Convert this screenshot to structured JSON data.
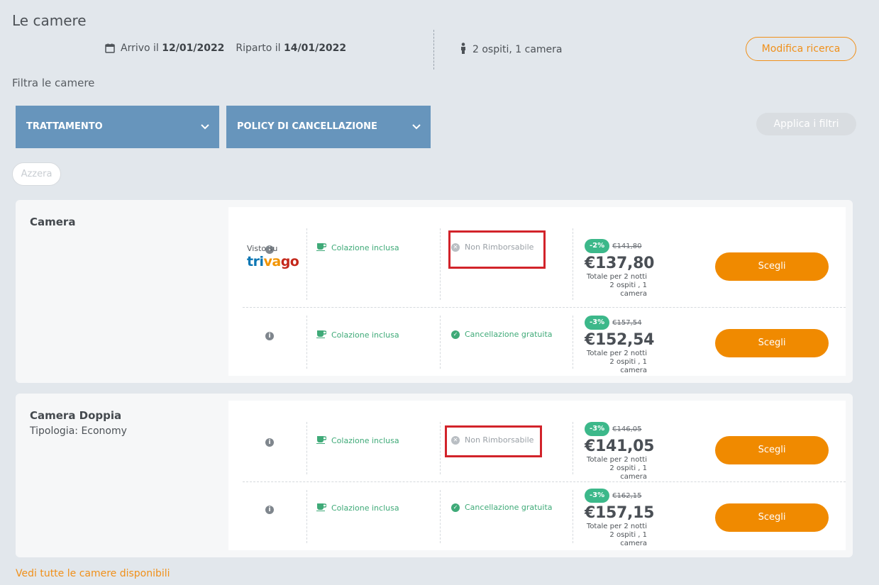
{
  "header": {
    "title": "Le camere",
    "arrival_label": "Arrivo il",
    "arrival_date": "12/01/2022",
    "departure_label": "Riparto il",
    "departure_date": "14/01/2022",
    "guests": "2 ospiti, 1 camera",
    "modify_button": "Modifica ricerca"
  },
  "filters": {
    "label": "Filtra le camere",
    "treatment": "TRATTAMENTO",
    "cancellation_policy": "POLICY DI CANCELLAZIONE",
    "apply_button": "Applica i filtri",
    "reset_button": "Azzera"
  },
  "rooms": [
    {
      "name": "Camera",
      "subtitle": "",
      "rates": [
        {
          "source_label": "Visto su",
          "source_logo": "trivago",
          "meal": "Colazione inclusa",
          "policy": "Non Rimborsabile",
          "discount": "-2%",
          "old_price": "€141,80",
          "price": "€137,80",
          "note_1": "Totale per 2 notti",
          "note_2": "2 ospiti , 1 camera",
          "button": "Scegli"
        },
        {
          "meal": "Colazione inclusa",
          "policy": "Cancellazione gratuita",
          "discount": "-3%",
          "old_price": "€157,54",
          "price": "€152,54",
          "note_1": "Totale per 2 notti",
          "note_2": "2 ospiti , 1 camera",
          "button": "Scegli"
        }
      ]
    },
    {
      "name": "Camera Doppia",
      "subtitle": "Tipologia: Economy",
      "rates": [
        {
          "meal": "Colazione inclusa",
          "policy": "Non Rimborsabile",
          "discount": "-3%",
          "old_price": "€146,05",
          "price": "€141,05",
          "note_1": "Totale per 2 notti",
          "note_2": "2 ospiti , 1 camera",
          "button": "Scegli"
        },
        {
          "meal": "Colazione inclusa",
          "policy": "Cancellazione gratuita",
          "discount": "-3%",
          "old_price": "€162,15",
          "price": "€157,15",
          "note_1": "Totale per 2 notti",
          "note_2": "2 ospiti , 1 camera",
          "button": "Scegli"
        }
      ]
    }
  ],
  "footer": {
    "see_all": "Vedi tutte le camere disponibili"
  },
  "colors": {
    "accent_orange": "#f08a00",
    "filter_blue": "#6795bc",
    "badge_green": "#3cb88a",
    "highlight_red": "#d2232a"
  }
}
